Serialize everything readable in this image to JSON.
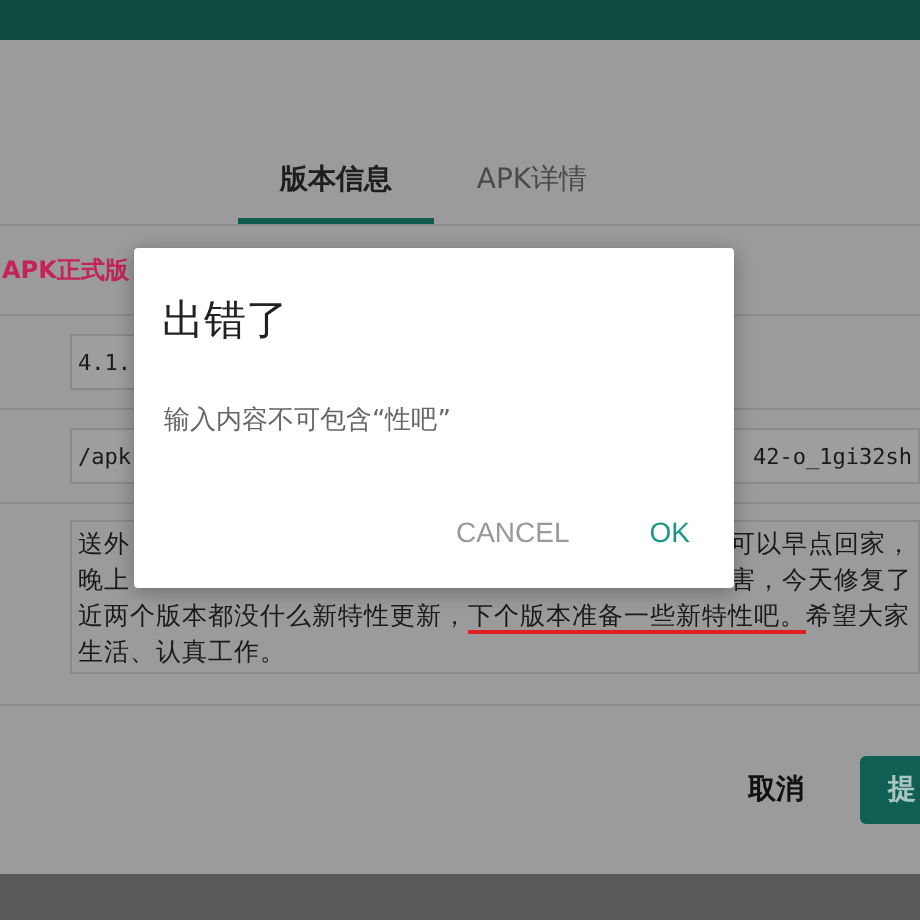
{
  "tabs": [
    {
      "label": "版本信息",
      "selected": true
    },
    {
      "label": "APK详情",
      "selected": false
    }
  ],
  "version_label": "APK正式版",
  "version_field": {
    "value": "4.1."
  },
  "path_field": {
    "value_left": "/apk",
    "value_right": "42-o_1gi32sh"
  },
  "notes": {
    "lines": [
      {
        "segments": [
          {
            "text": "送外",
            "marked": false
          }
        ],
        "right": "可以早点回家，"
      },
      {
        "segments": [
          {
            "text": "晚上",
            "marked": false
          }
        ],
        "right": "害，今天修复了"
      },
      {
        "segments": [
          {
            "text": "近两个版本都没什么新特性更新，",
            "marked": false
          },
          {
            "text": "下个版本准备一些新特性吧。",
            "marked": true
          },
          {
            "text": "希望大家",
            "marked": false
          }
        ]
      },
      {
        "segments": [
          {
            "text": "生活、认真工作。",
            "marked": false
          }
        ]
      }
    ]
  },
  "actions": {
    "cancel": "取消",
    "submit": "提"
  },
  "dialog": {
    "title": "出错了",
    "message": "输入内容不可包含“性吧”",
    "buttons": [
      {
        "label": "CANCEL",
        "kind": "neutral"
      },
      {
        "label": "OK",
        "kind": "positive"
      }
    ]
  }
}
